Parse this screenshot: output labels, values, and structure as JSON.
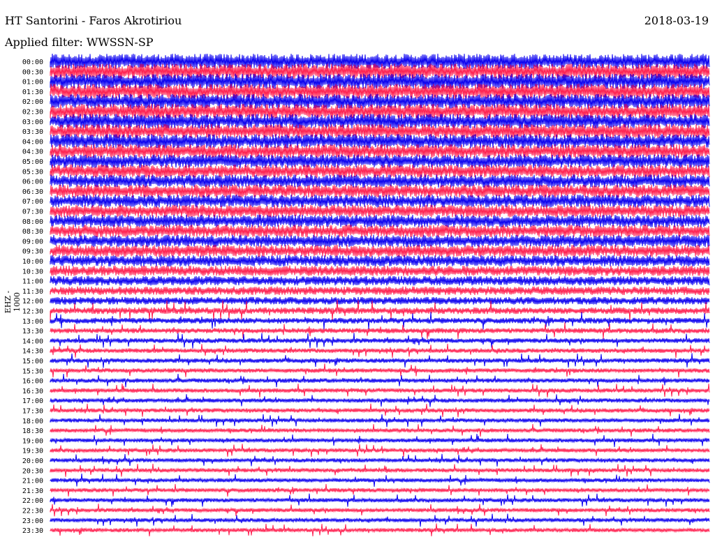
{
  "header": {
    "station": "HT Santorini - Faros Akrotiriou",
    "date": "2018-03-19",
    "filter": "Applied filter: WWSSN-SP",
    "channel": "EHZ - 1000"
  },
  "colors": {
    "odd_trace": "#0a00f0",
    "even_trace": "#ff1f4f"
  },
  "chart_data": {
    "type": "line",
    "title": "HT Santorini - Faros Akrotiriou",
    "ylabel": "EHZ - 1000",
    "xlabel": "",
    "grid": false,
    "tick_labels": [
      "00:00",
      "00:30",
      "01:00",
      "01:30",
      "02:00",
      "02:30",
      "03:00",
      "03:30",
      "04:00",
      "04:30",
      "05:00",
      "05:30",
      "06:00",
      "06:30",
      "07:00",
      "07:30",
      "08:00",
      "08:30",
      "09:00",
      "09:30",
      "10:00",
      "10:30",
      "11:00",
      "11:30",
      "12:00",
      "12:30",
      "13:00",
      "13:30",
      "14:00",
      "14:30",
      "15:00",
      "15:30",
      "16:00",
      "16:30",
      "17:00",
      "17:30",
      "18:00",
      "18:30",
      "19:00",
      "19:30",
      "20:00",
      "20:30",
      "21:00",
      "21:30",
      "22:00",
      "22:30",
      "23:00",
      "23:30"
    ],
    "relative_noise_amplitude": [
      1.0,
      1.0,
      1.0,
      0.98,
      0.97,
      0.96,
      0.95,
      0.93,
      0.92,
      0.9,
      0.88,
      0.86,
      0.85,
      0.84,
      0.83,
      0.82,
      0.82,
      0.81,
      0.8,
      0.78,
      0.74,
      0.68,
      0.62,
      0.56,
      0.5,
      0.44,
      0.38,
      0.34,
      0.32,
      0.3,
      0.3,
      0.29,
      0.29,
      0.28,
      0.28,
      0.28,
      0.27,
      0.27,
      0.27,
      0.27,
      0.27,
      0.27,
      0.27,
      0.27,
      0.27,
      0.27,
      0.27,
      0.27
    ]
  }
}
